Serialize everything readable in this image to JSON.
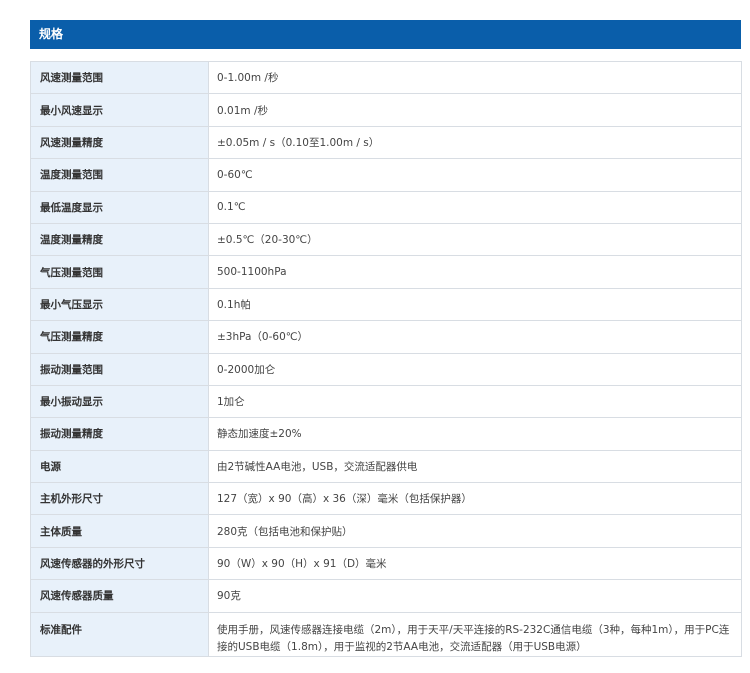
{
  "section_title": "规格",
  "rows": [
    {
      "label": "风速测量范围",
      "value": "0-1.00m /秒"
    },
    {
      "label": "最小风速显示",
      "value": "0.01m /秒"
    },
    {
      "label": "风速测量精度",
      "value": "±0.05m / s（0.10至1.00m / s）"
    },
    {
      "label": "温度测量范围",
      "value": "0-60℃"
    },
    {
      "label": "最低温度显示",
      "value": "0.1℃"
    },
    {
      "label": "温度测量精度",
      "value": "±0.5℃（20-30℃）"
    },
    {
      "label": "气压测量范围",
      "value": "500-1100hPa"
    },
    {
      "label": "最小气压显示",
      "value": "0.1h帕"
    },
    {
      "label": "气压测量精度",
      "value": "±3hPa（0-60℃）"
    },
    {
      "label": "振动测量范围",
      "value": "0-2000加仑"
    },
    {
      "label": "最小振动显示",
      "value": "1加仑"
    },
    {
      "label": "振动测量精度",
      "value": "静态加速度±20%"
    },
    {
      "label": "电源",
      "value": "由2节碱性AA电池，USB，交流适配器供电"
    },
    {
      "label": "主机外形尺寸",
      "value": "127（宽）x 90（高）x 36（深）毫米（包括保护器）"
    },
    {
      "label": "主体质量",
      "value": "280克（包括电池和保护贴）"
    },
    {
      "label": "风速传感器的外形尺寸",
      "value": "90（W）x 90（H）x 91（D）毫米"
    },
    {
      "label": "风速传感器质量",
      "value": "90克"
    },
    {
      "label": "标准配件",
      "value": "使用手册，风速传感器连接电缆（2m），用于天平/天平连接的RS-232C通信电缆（3种，每种1m），用于PC连接的USB电缆（1.8m），用于监视的2节AA电池，交流适配器（用于USB电源）"
    }
  ]
}
